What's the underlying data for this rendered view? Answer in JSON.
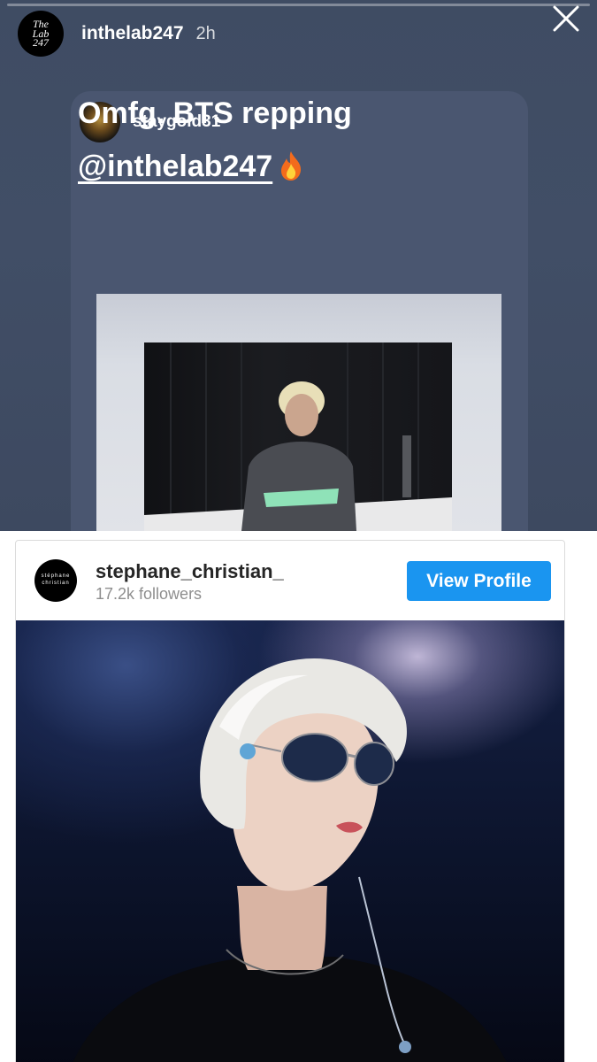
{
  "story": {
    "username": "inthelab247",
    "time_ago": "2h",
    "avatar_text": [
      "The",
      "Lab",
      "247"
    ],
    "close_icon": "close-icon",
    "progress_percent": 0,
    "shared_post": {
      "username": "staygold31",
      "text_line1": "Omfg. BTS repping",
      "mention": "@inthelab247",
      "emoji_icon": "flame-icon"
    }
  },
  "profile_card": {
    "username": "stephane_christian_",
    "followers": "17.2k followers",
    "button_label": "View Profile",
    "avatar_text": [
      "stéphane",
      "christian"
    ]
  },
  "colors": {
    "story_bg": "#404c64",
    "card_bg": "#4a5670",
    "button_blue": "#1a95f0",
    "muted_text": "#8e8e8e"
  }
}
